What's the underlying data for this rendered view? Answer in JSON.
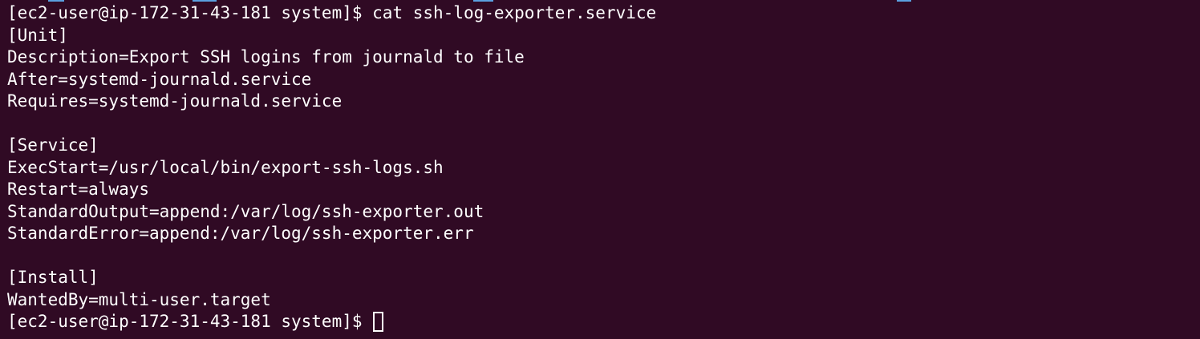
{
  "terminal": {
    "colors": {
      "background": "#300a24",
      "foreground": "#ffffff"
    },
    "prompt": "[ec2-user@ip-172-31-43-181 system]$ ",
    "command": "cat ssh-log-exporter.service",
    "output": [
      "[Unit]",
      "Description=Export SSH logins from journald to file",
      "After=systemd-journald.service",
      "Requires=systemd-journald.service",
      "",
      "[Service]",
      "ExecStart=/usr/local/bin/export-ssh-logs.sh",
      "Restart=always",
      "StandardOutput=append:/var/log/ssh-exporter.out",
      "StandardError=append:/var/log/ssh-exporter.err",
      "",
      "[Install]",
      "WantedBy=multi-user.target"
    ],
    "final_prompt": "[ec2-user@ip-172-31-43-181 system]$ "
  }
}
